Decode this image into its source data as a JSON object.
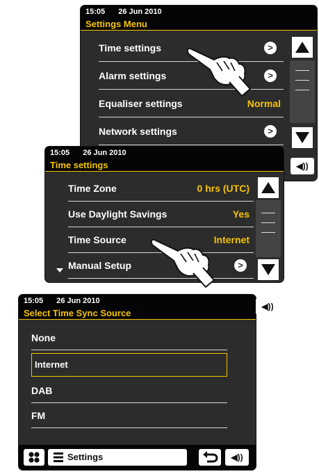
{
  "screen1": {
    "time": "15:05",
    "date": "26 Jun 2010",
    "title": "Settings Menu",
    "items": [
      {
        "label": "Time settings",
        "chevron": ">"
      },
      {
        "label": "Alarm settings",
        "chevron": ">"
      },
      {
        "label": "Equaliser settings",
        "value": "Normal"
      },
      {
        "label": "Network settings",
        "chevron": ">"
      }
    ],
    "volume_label": "◀))"
  },
  "screen2": {
    "time": "15:05",
    "date": "26 Jun 2010",
    "title": "Time settings",
    "items": [
      {
        "label": "Time Zone",
        "value": "0 hrs (UTC)"
      },
      {
        "label": "Use Daylight Savings",
        "value": "Yes"
      },
      {
        "label": "Time Source",
        "value": "Internet"
      },
      {
        "label": "Manual Setup",
        "chevron": ">"
      }
    ],
    "volume_label": "◀))"
  },
  "screen3": {
    "time": "15:05",
    "date": "26 Jun 2010",
    "title": "Select Time Sync Source",
    "options": [
      "None",
      "Internet",
      "DAB",
      "FM"
    ],
    "selected_option": "Internet",
    "bottom_settings_label": "Settings",
    "volume_label": "◀))"
  },
  "colors": {
    "accent": "#f5c400",
    "screen_bg": "#2c2c2c",
    "bar_bg": "#050505",
    "text": "#ffffff"
  },
  "icons": [
    "chevron-right-icon",
    "scroll-up-arrow-icon",
    "scroll-down-arrow-icon",
    "volume-icon",
    "pointing-hand-icon",
    "grid-menu-icon",
    "hamburger-icon",
    "back-arrow-icon"
  ]
}
